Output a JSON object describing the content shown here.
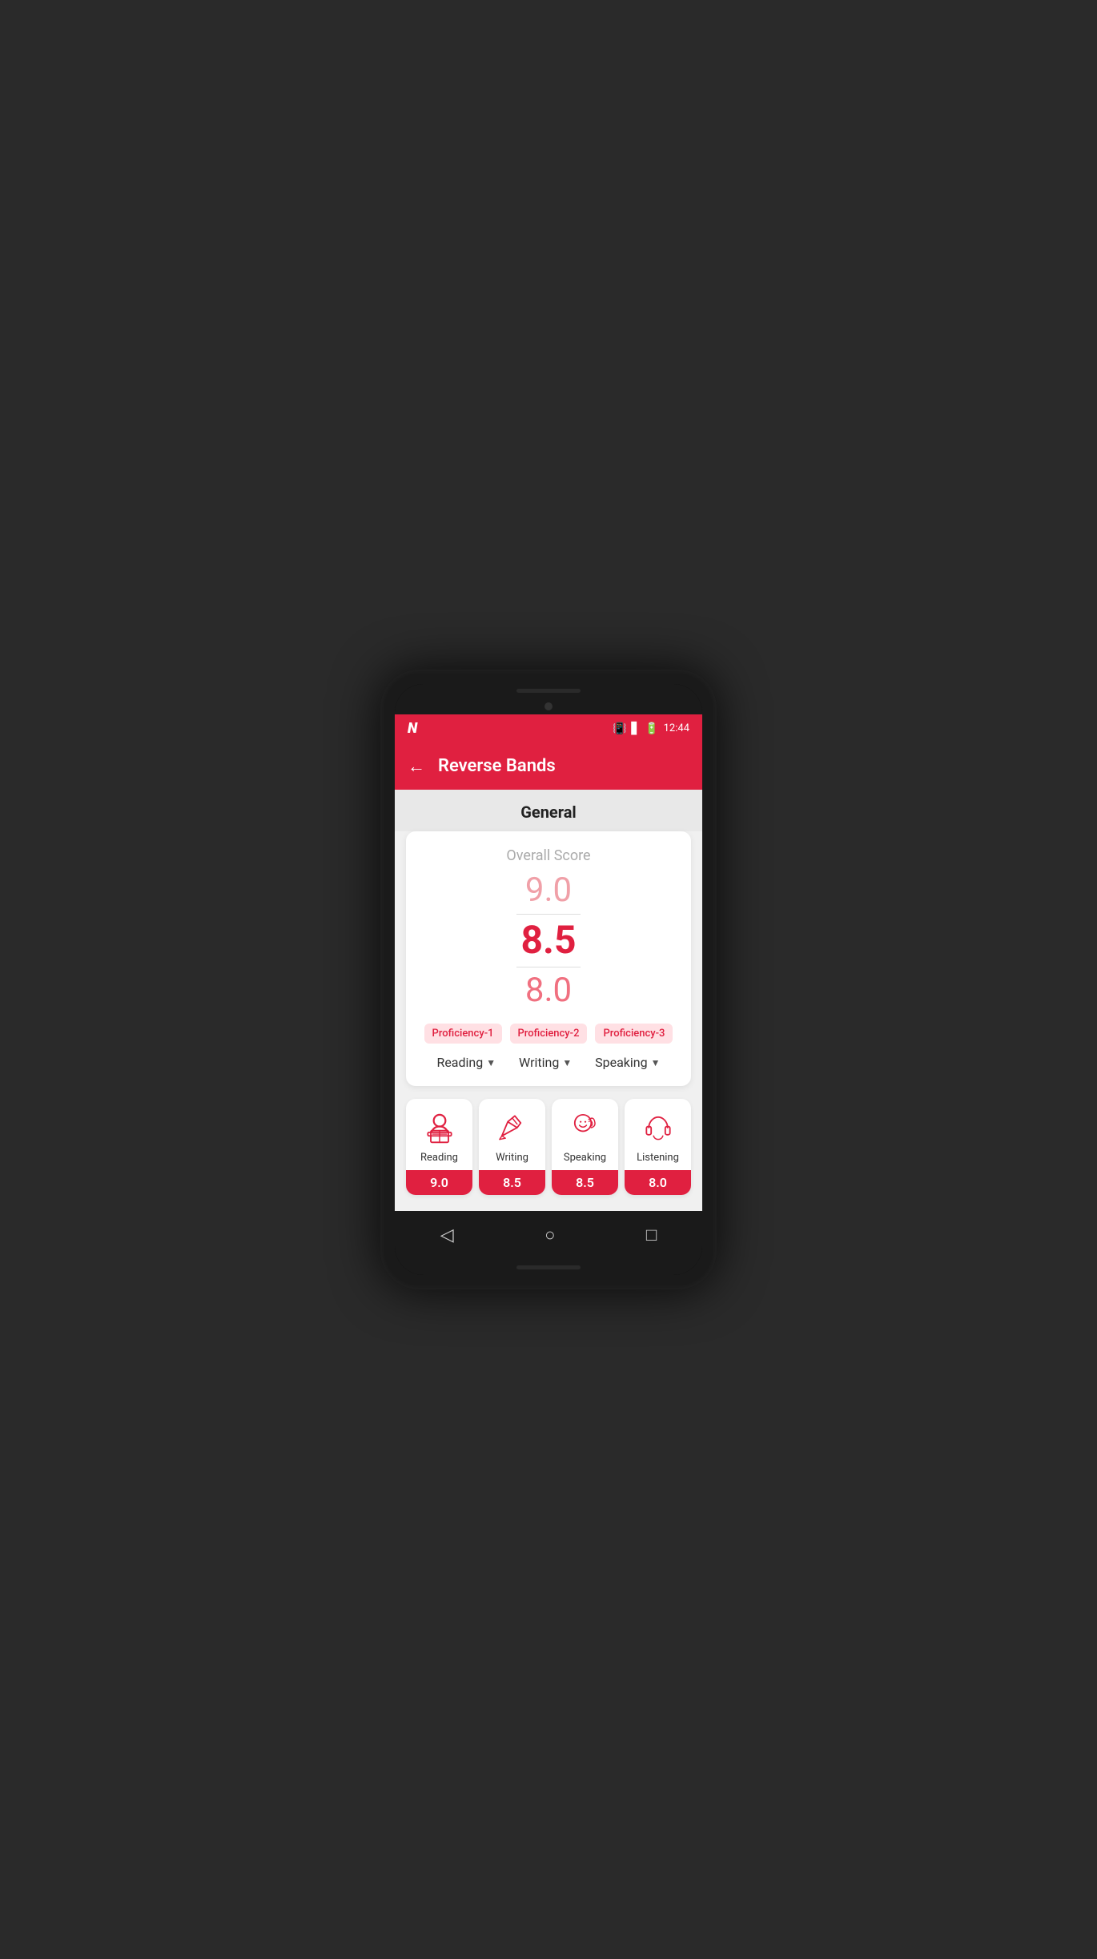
{
  "statusBar": {
    "logo": "N",
    "time": "12:44",
    "vibrate_icon": "📳",
    "signal_icon": "📶",
    "battery_icon": "🔋"
  },
  "appBar": {
    "backLabel": "←",
    "title": "Reverse Bands"
  },
  "content": {
    "sectionTitle": "General",
    "overallScoreLabel": "Overall Score",
    "scores": {
      "top": "9.0",
      "middle": "8.5",
      "bottom": "8.0"
    },
    "proficiencies": [
      "Proficiency-1",
      "Proficiency-2",
      "Proficiency-3"
    ],
    "skillDropdowns": [
      "Reading",
      "Writing",
      "Speaking"
    ],
    "skillCards": [
      {
        "name": "Reading",
        "score": "9.0"
      },
      {
        "name": "Writing",
        "score": "8.5"
      },
      {
        "name": "Speaking",
        "score": "8.5"
      },
      {
        "name": "Listening",
        "score": "8.0"
      }
    ]
  },
  "navBar": {
    "back": "◁",
    "home": "○",
    "recent": "□"
  }
}
